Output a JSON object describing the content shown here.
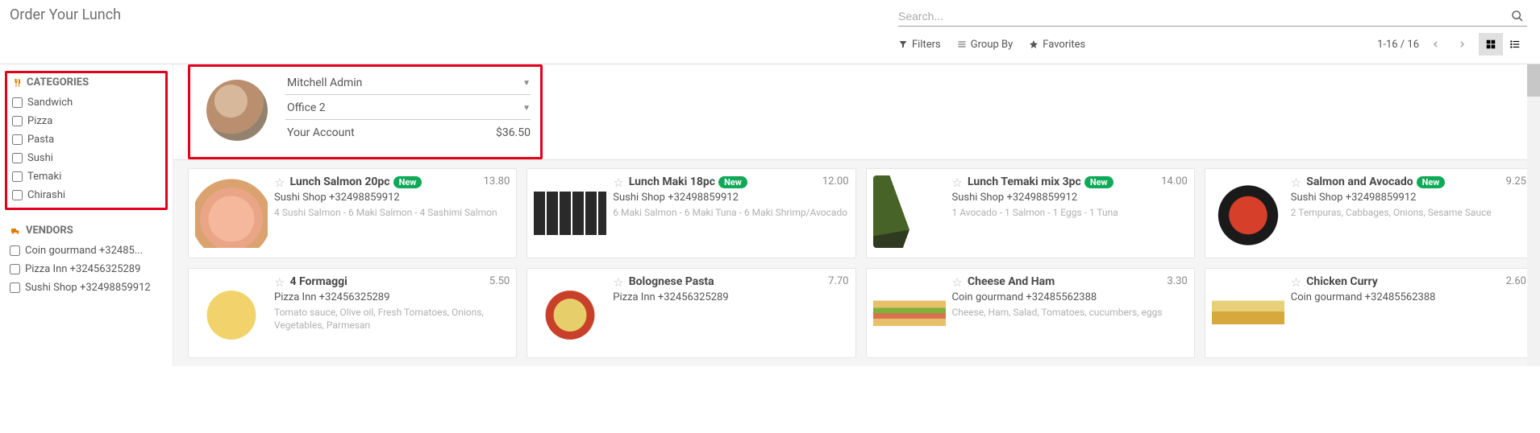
{
  "header": {
    "title": "Order Your Lunch",
    "search_placeholder": "Search...",
    "filters_label": "Filters",
    "groupby_label": "Group By",
    "favorites_label": "Favorites",
    "pager": "1-16 / 16"
  },
  "sidebar": {
    "categories": {
      "header": "CATEGORIES",
      "items": [
        "Sandwich",
        "Pizza",
        "Pasta",
        "Sushi",
        "Temaki",
        "Chirashi"
      ]
    },
    "vendors": {
      "header": "VENDORS",
      "items": [
        "Coin gourmand +32485...",
        "Pizza Inn +32456325289",
        "Sushi Shop +32498859912"
      ]
    }
  },
  "account": {
    "user": "Mitchell Admin",
    "location": "Office 2",
    "balance_label": "Your Account",
    "balance_value": "$36.50"
  },
  "products": [
    {
      "title": "Lunch Salmon 20pc",
      "is_new": true,
      "price": "13.80",
      "vendor": "Sushi Shop +32498859912",
      "desc": "4 Sushi Salmon - 6 Maki Salmon - 4 Sashimi Salmon",
      "img": "food-salmon"
    },
    {
      "title": "Lunch Maki 18pc",
      "is_new": true,
      "price": "12.00",
      "vendor": "Sushi Shop +32498859912",
      "desc": "6 Maki Salmon - 6 Maki Tuna - 6 Maki Shrimp/Avocado",
      "img": "food-maki"
    },
    {
      "title": "Lunch Temaki mix 3pc",
      "is_new": true,
      "price": "14.00",
      "vendor": "Sushi Shop +32498859912",
      "desc": "1 Avocado - 1 Salmon - 1 Eggs - 1 Tuna",
      "img": "food-temaki"
    },
    {
      "title": "Salmon and Avocado",
      "is_new": true,
      "price": "9.25",
      "vendor": "Sushi Shop +32498859912",
      "desc": "2 Tempuras, Cabbages, Onions, Sesame Sauce",
      "img": "food-bowl"
    },
    {
      "title": "4 Formaggi",
      "is_new": false,
      "price": "5.50",
      "vendor": "Pizza Inn +32456325289",
      "desc": "Tomato sauce, Olive oil, Fresh Tomatoes, Onions, Vegetables, Parmesan",
      "img": "food-pasta1"
    },
    {
      "title": "Bolognese Pasta",
      "is_new": false,
      "price": "7.70",
      "vendor": "Pizza Inn +32456325289",
      "desc": "",
      "img": "food-pasta2"
    },
    {
      "title": "Cheese And Ham",
      "is_new": false,
      "price": "3.30",
      "vendor": "Coin gourmand +32485562388",
      "desc": "Cheese, Ham, Salad, Tomatoes, cucumbers, eggs",
      "img": "food-sandwich"
    },
    {
      "title": "Chicken Curry",
      "is_new": false,
      "price": "2.60",
      "vendor": "Coin gourmand +32485562388",
      "desc": "",
      "img": "food-curry"
    }
  ],
  "labels": {
    "new_badge": "New"
  }
}
